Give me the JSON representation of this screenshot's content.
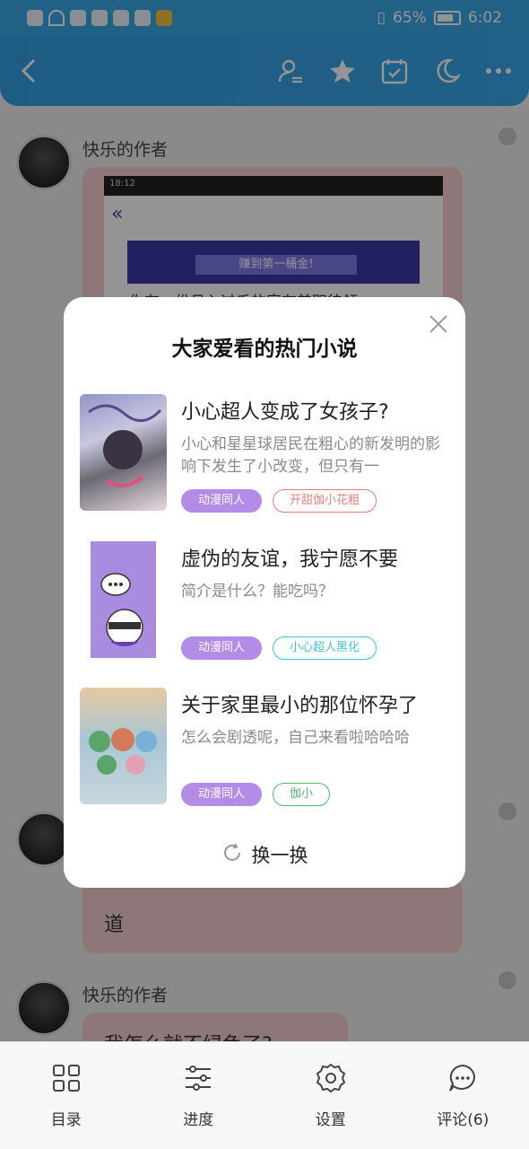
{
  "status_bar": {
    "battery_percent": "65%",
    "time": "6:02"
  },
  "app_bar": {
    "icons": [
      "back-arrow-icon",
      "author-switch-icon",
      "star-icon",
      "calendar-check-icon",
      "moon-icon",
      "more-dots-icon"
    ]
  },
  "chat": {
    "messages": [
      {
        "author": "快乐的作者",
        "preview_banner": "赚到第一桶金!",
        "preview_time": "18:12",
        "preview_line": "你有一份月入过千的富有兼职待领"
      },
      {
        "author": "",
        "text": "道"
      },
      {
        "author": "快乐的作者",
        "text": "我怎么就不绿色了?"
      }
    ]
  },
  "modal": {
    "title": "大家爱看的热门小说",
    "books": [
      {
        "title": "小心超人变成了女孩子?",
        "description": "小心和星星球居民在粗心的新发明的影响下发生了小改变，但只有一",
        "tags": [
          {
            "label": "动漫同人",
            "style": "purple"
          },
          {
            "label": "开甜伽小花粗",
            "style": "red"
          }
        ]
      },
      {
        "title": "虚伪的友谊，我宁愿不要",
        "description": "简介是什么？能吃吗？",
        "tags": [
          {
            "label": "动漫同人",
            "style": "purple"
          },
          {
            "label": "小心超人黑化",
            "style": "cyan"
          }
        ]
      },
      {
        "title": "关于家里最小的那位怀孕了",
        "description": "怎么会剧透呢，自己来看啦哈哈哈",
        "tags": [
          {
            "label": "动漫同人",
            "style": "purple"
          },
          {
            "label": "伽小",
            "style": "green"
          }
        ]
      }
    ],
    "refresh_label": "换一换"
  },
  "bottom_nav": [
    {
      "label": "目录",
      "icon": "grid-icon"
    },
    {
      "label": "进度",
      "icon": "sliders-icon"
    },
    {
      "label": "设置",
      "icon": "gear-icon"
    },
    {
      "label": "评论(6)",
      "icon": "comment-icon"
    }
  ],
  "colors": {
    "accent": "#3aa6e8",
    "tag_purple": "#b38ce8",
    "bubble_pink": "#f4cdd1"
  }
}
